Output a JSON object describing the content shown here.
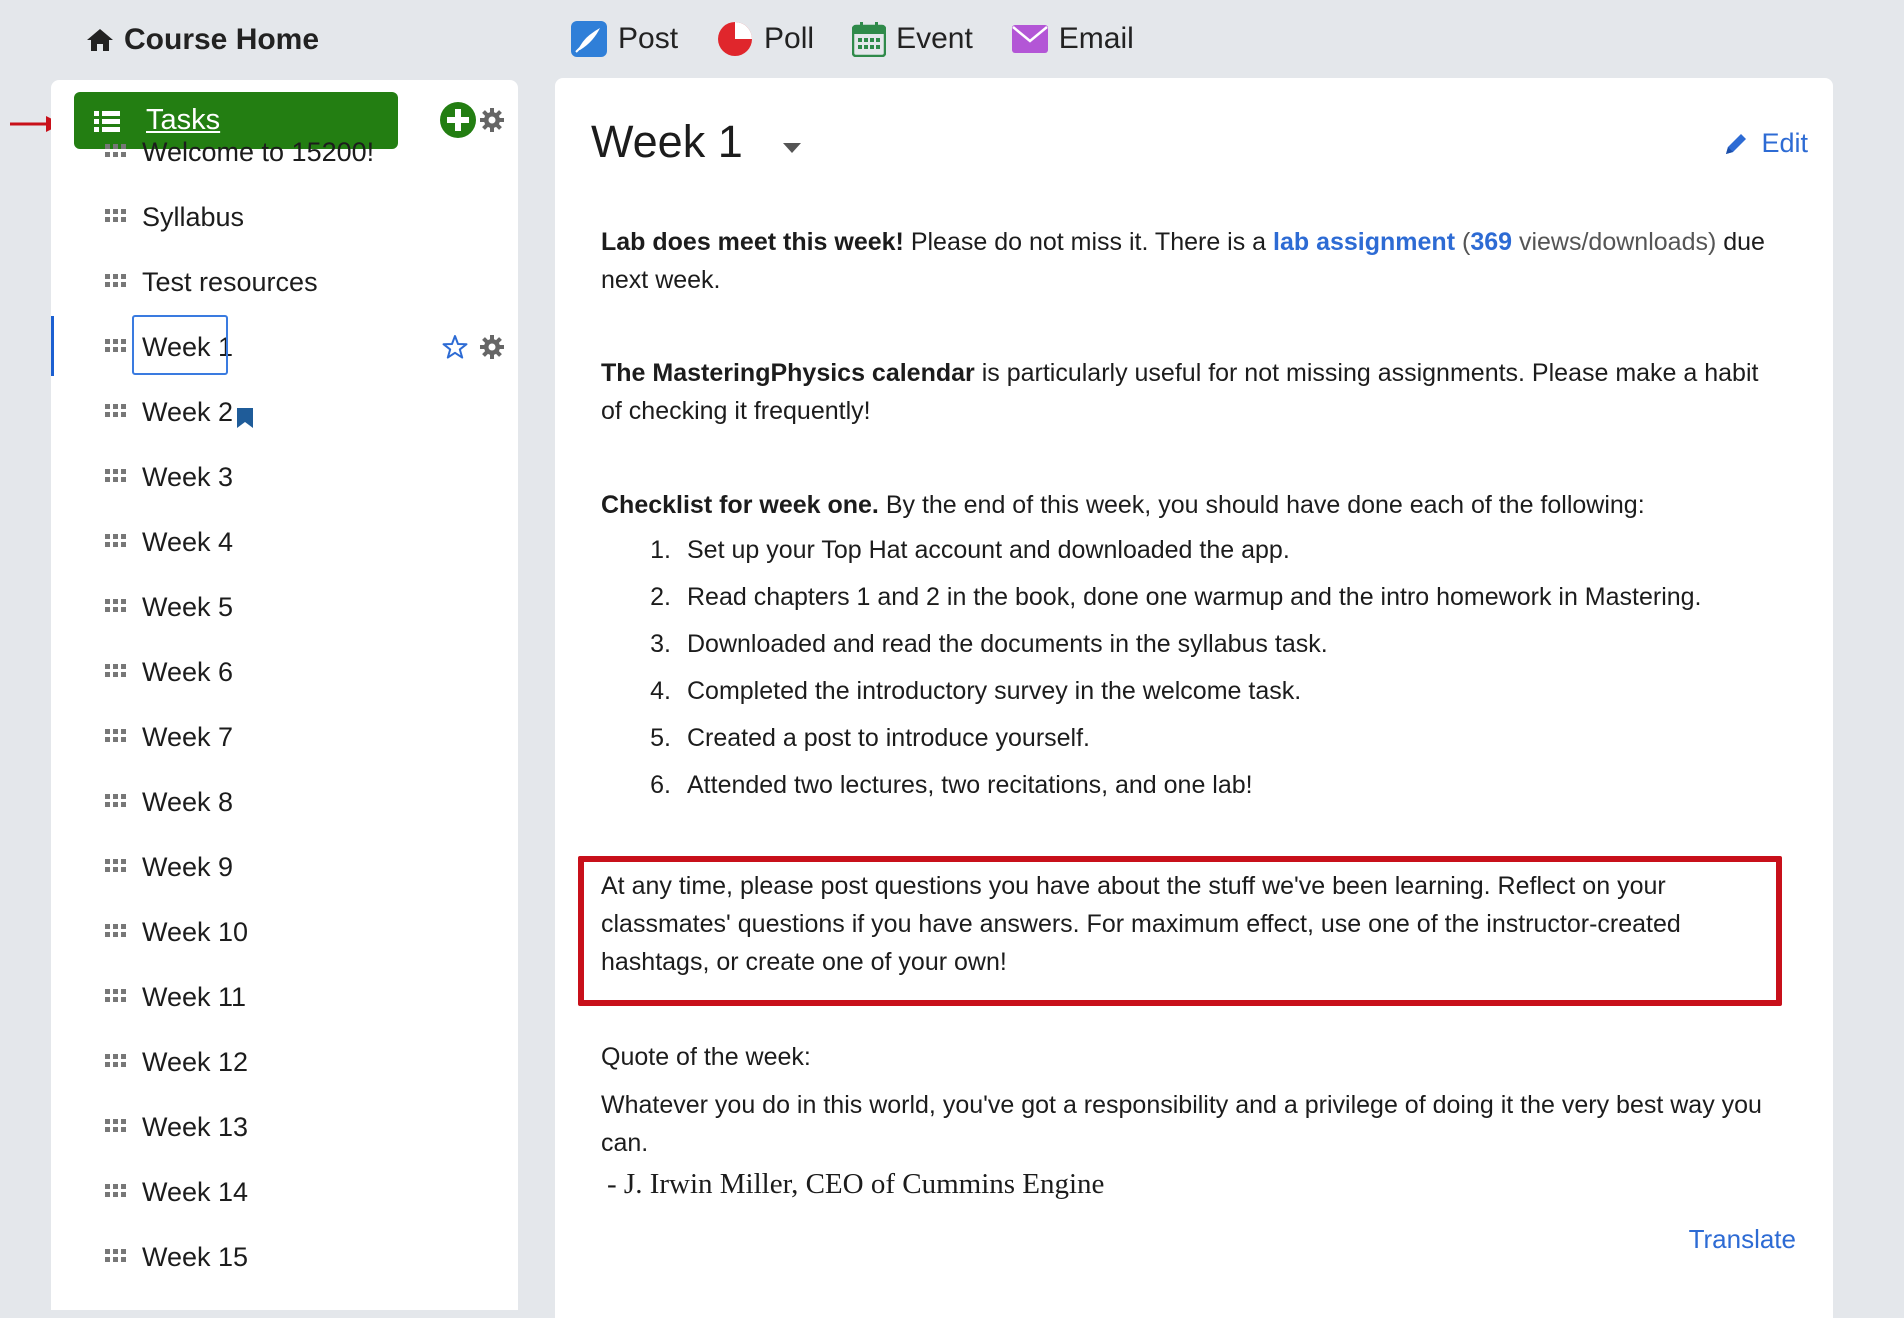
{
  "top": {
    "home_label": "Course Home",
    "actions": [
      {
        "label": "Post",
        "icon": "post-icon"
      },
      {
        "label": "Poll",
        "icon": "poll-icon"
      },
      {
        "label": "Event",
        "icon": "calendar-icon"
      },
      {
        "label": "Email",
        "icon": "envelope-icon"
      }
    ]
  },
  "sidebar": {
    "tasks_label": "Tasks",
    "items": [
      {
        "label": "Welcome to 15200!"
      },
      {
        "label": "Syllabus"
      },
      {
        "label": "Test resources"
      },
      {
        "label": "Week 1",
        "active": true
      },
      {
        "label": "Week 2",
        "bookmarked": true
      },
      {
        "label": "Week 3"
      },
      {
        "label": "Week 4"
      },
      {
        "label": "Week 5"
      },
      {
        "label": "Week 6"
      },
      {
        "label": "Week 7"
      },
      {
        "label": "Week 8"
      },
      {
        "label": "Week 9"
      },
      {
        "label": "Week 10"
      },
      {
        "label": "Week 11"
      },
      {
        "label": "Week 12"
      },
      {
        "label": "Week 13"
      },
      {
        "label": "Week 14"
      },
      {
        "label": "Week 15"
      }
    ]
  },
  "main": {
    "title": "Week 1",
    "edit_label": "Edit",
    "para1": {
      "bold": "Lab does meet this week!",
      "text1": " Please do not miss it. There is a ",
      "link": "lab assignment",
      "paren_open": " (",
      "count": "369",
      "views": " views/downloads)",
      "text2": " due next week."
    },
    "para2": {
      "bold": "The MasteringPhysics calendar",
      "text": " is particularly useful for not missing assignments. Please make a habit of checking it frequently!"
    },
    "checklist_intro": {
      "bold": "Checklist for week one.",
      "text": " By the end of this week, you should have done each of the following:"
    },
    "checklist": [
      {
        "num": "1.",
        "text": "Set up your Top Hat account and downloaded the app."
      },
      {
        "num": "2.",
        "text": "Read chapters 1 and 2 in the book, done one warmup and the intro homework in Mastering."
      },
      {
        "num": "3.",
        "text": "Downloaded and read the documents in the syllabus task."
      },
      {
        "num": "4.",
        "text": "Completed the introductory survey in the welcome task."
      },
      {
        "num": "5.",
        "text": "Created a post to introduce yourself."
      },
      {
        "num": "6.",
        "text": "Attended two lectures, two recitations, and one lab!"
      }
    ],
    "highlight": "At any time, please post questions you have about the stuff we've been learning. Reflect on your classmates' questions if you have answers. For maximum effect, use one of the instructor-created hashtags, or create one of your own!",
    "quote_label": "Quote of the week:",
    "quote": "Whatever you do in this world, you've got a responsibility and a privilege of doing it the very best way you can.",
    "quote_attr": "- J. Irwin Miller, CEO of Cummins Engine",
    "translate_label": "Translate"
  },
  "colors": {
    "tasks_green": "#237e12",
    "link_blue": "#2d6bd4",
    "highlight_red": "#c8101a",
    "page_bg": "#e4e7eb"
  }
}
